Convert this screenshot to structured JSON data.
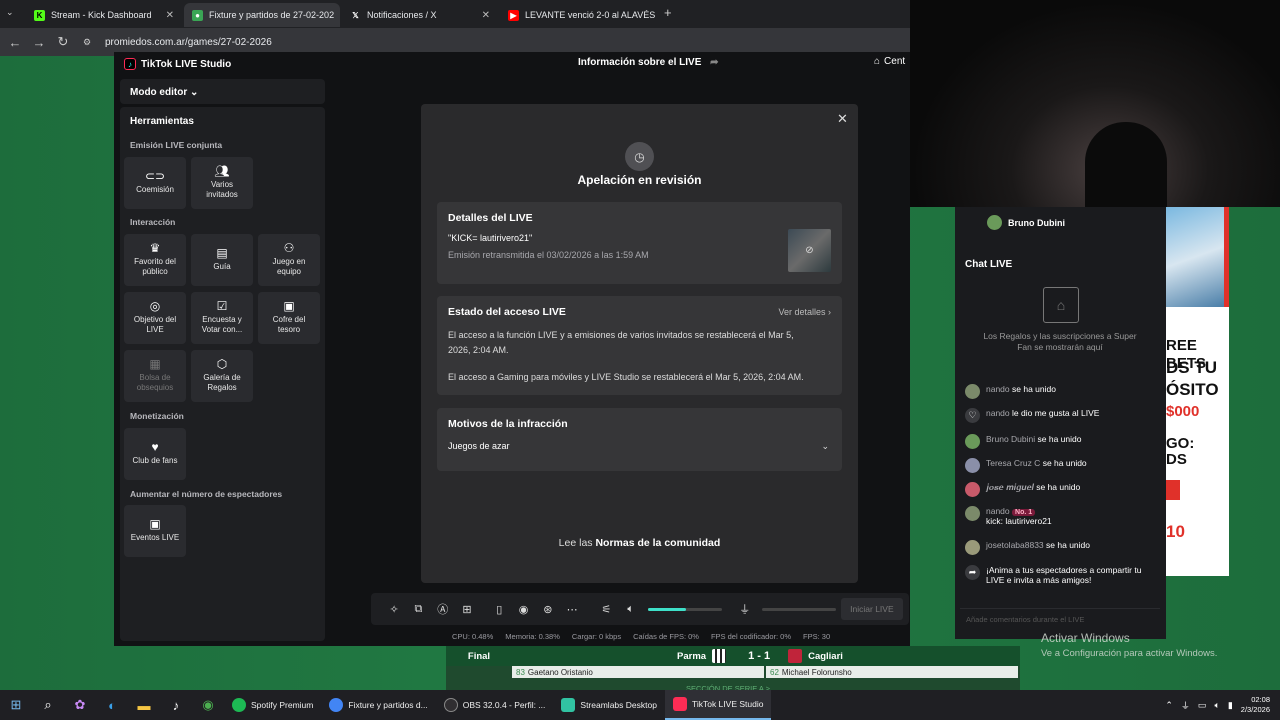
{
  "browser": {
    "tabs": [
      {
        "label": "Stream - Kick Dashboard",
        "icon": "kick-icon",
        "active": false
      },
      {
        "label": "Fixture y partidos de 27-02-202",
        "icon": "promiedos-icon",
        "active": true
      },
      {
        "label": "Notificaciones / X",
        "icon": "x-icon",
        "active": false
      },
      {
        "label": "LEVANTE venció 2-0 al ALAVÉS",
        "icon": "youtube-icon",
        "active": false
      }
    ],
    "url": "promiedos.com.ar/games/27-02-2026"
  },
  "studio": {
    "app_title": "TikTok LIVE Studio",
    "header_info": "Información sobre el LIVE",
    "header_home": "Cent",
    "editor_mode": "Modo editor",
    "tools_title": "Herramientas",
    "sections": {
      "joint": "Emisión LIVE conjunta",
      "interaction": "Interacción",
      "monetization": "Monetización",
      "viewers": "Aumentar el número de espectadores"
    },
    "tiles": {
      "coemision": "Coemisión",
      "varios_1": "Varios",
      "varios_2": "invitados",
      "favorito_1": "Favorito del",
      "favorito_2": "público",
      "guia": "Guía",
      "juego_1": "Juego en",
      "juego_2": "equipo",
      "objetivo_1": "Objetivo del",
      "objetivo_2": "LIVE",
      "encuesta_1": "Encuesta y",
      "encuesta_2": "Votar con...",
      "cofre_1": "Cofre del",
      "cofre_2": "tesoro",
      "bolsa_1": "Bolsa de",
      "bolsa_2": "obsequios",
      "galeria_1": "Galería de",
      "galeria_2": "Regalos",
      "club": "Club de fans",
      "eventos": "Eventos LIVE"
    }
  },
  "modal": {
    "title": "Apelación en revisión",
    "details_title": "Detalles del LIVE",
    "live_name": "\"KICK= lautirivero21\"",
    "broadcast_date": "Emisión retransmitida el 03/02/2026 a las 1:59 AM",
    "access_title": "Estado del acceso LIVE",
    "view_details": "Ver detalles",
    "access_text_1": "El acceso a la función LIVE y a emisiones de varios invitados se restablecerá el Mar 5,",
    "access_text_1b": "2026, 2:04 AM.",
    "access_text_2": "El acceso a Gaming para móviles y LIVE Studio se restablecerá el Mar 5, 2026, 2:04 AM.",
    "reasons_title": "Motivos de la infracción",
    "reason": "Juegos de azar",
    "norms_prefix": "Lee las",
    "norms_link": "Normas de la comunidad"
  },
  "toolbar": {
    "start_label": "Iniciar LIVE",
    "volume_level": 0.52
  },
  "stats": {
    "cpu": "CPU:  0.48%",
    "memory": "Memoria:  0.38%",
    "upload": "Cargar:  0 kbps",
    "fps_drops": "Caídas de FPS:  0%",
    "encoder_fps": "FPS del codificador:  0%",
    "fps": "FPS:  30"
  },
  "chat": {
    "top_user": "Bruno Dubini",
    "title": "Chat LIVE",
    "empty_text": "Los Regalos y las suscripciones a Super Fan se mostrarán aquí",
    "messages": [
      {
        "user": "nando",
        "text": "se ha unido"
      },
      {
        "user": "nando",
        "text": "le dio me gusta al LIVE"
      },
      {
        "user": "Bruno Dubini",
        "text": "se ha unido"
      },
      {
        "user": "Teresa Cruz C",
        "text": "se ha unido"
      },
      {
        "user": "𝒋𝒐𝒔𝒆 𝒎𝒊𝒈𝒖𝒆𝒍",
        "text": "se ha unido"
      },
      {
        "user": "nando",
        "badge": "No. 1",
        "text": "kick: lautirivero21"
      },
      {
        "user": "josetolaba8833",
        "text": "se ha unido"
      }
    ],
    "share_prompt": "¡Anima a tus espectadores a compartir tu LIVE e invita a más amigos!",
    "input_placeholder": "Añade comentarios durante el LIVE"
  },
  "ad": {
    "line1": "REE BETS",
    "line2": "DS TU",
    "line3": "ÓSITO",
    "line4": "$000",
    "line5": "GO:",
    "line6": "DS",
    "line7": "10"
  },
  "match": {
    "status": "Final",
    "home": "Parma",
    "score": "1 - 1",
    "away": "Cagliari",
    "home_min": "83",
    "home_player": "Gaetano Oristanio",
    "away_min": "62",
    "away_player": "Michael Folorunsho",
    "more": "SECCIÓN DE SERIE A >"
  },
  "windows": {
    "activate_title": "Activar Windows",
    "activate_sub": "Ve a Configuración para activar Windows.",
    "taskbar_apps": [
      {
        "label": "Spotify Premium",
        "color": "#1db954",
        "active": false
      },
      {
        "label": "Fixture y partidos d...",
        "color": "#4285f4",
        "active": false
      },
      {
        "label": "OBS 32.0.4 - Perfil: ...",
        "color": "#302e31",
        "active": false
      },
      {
        "label": "Streamlabs Desktop",
        "color": "#31c3a2",
        "active": false
      },
      {
        "label": "TikTok LIVE Studio",
        "color": "#fe2c55",
        "active": true
      }
    ],
    "time": "02:08",
    "date": "2/3/2026"
  }
}
